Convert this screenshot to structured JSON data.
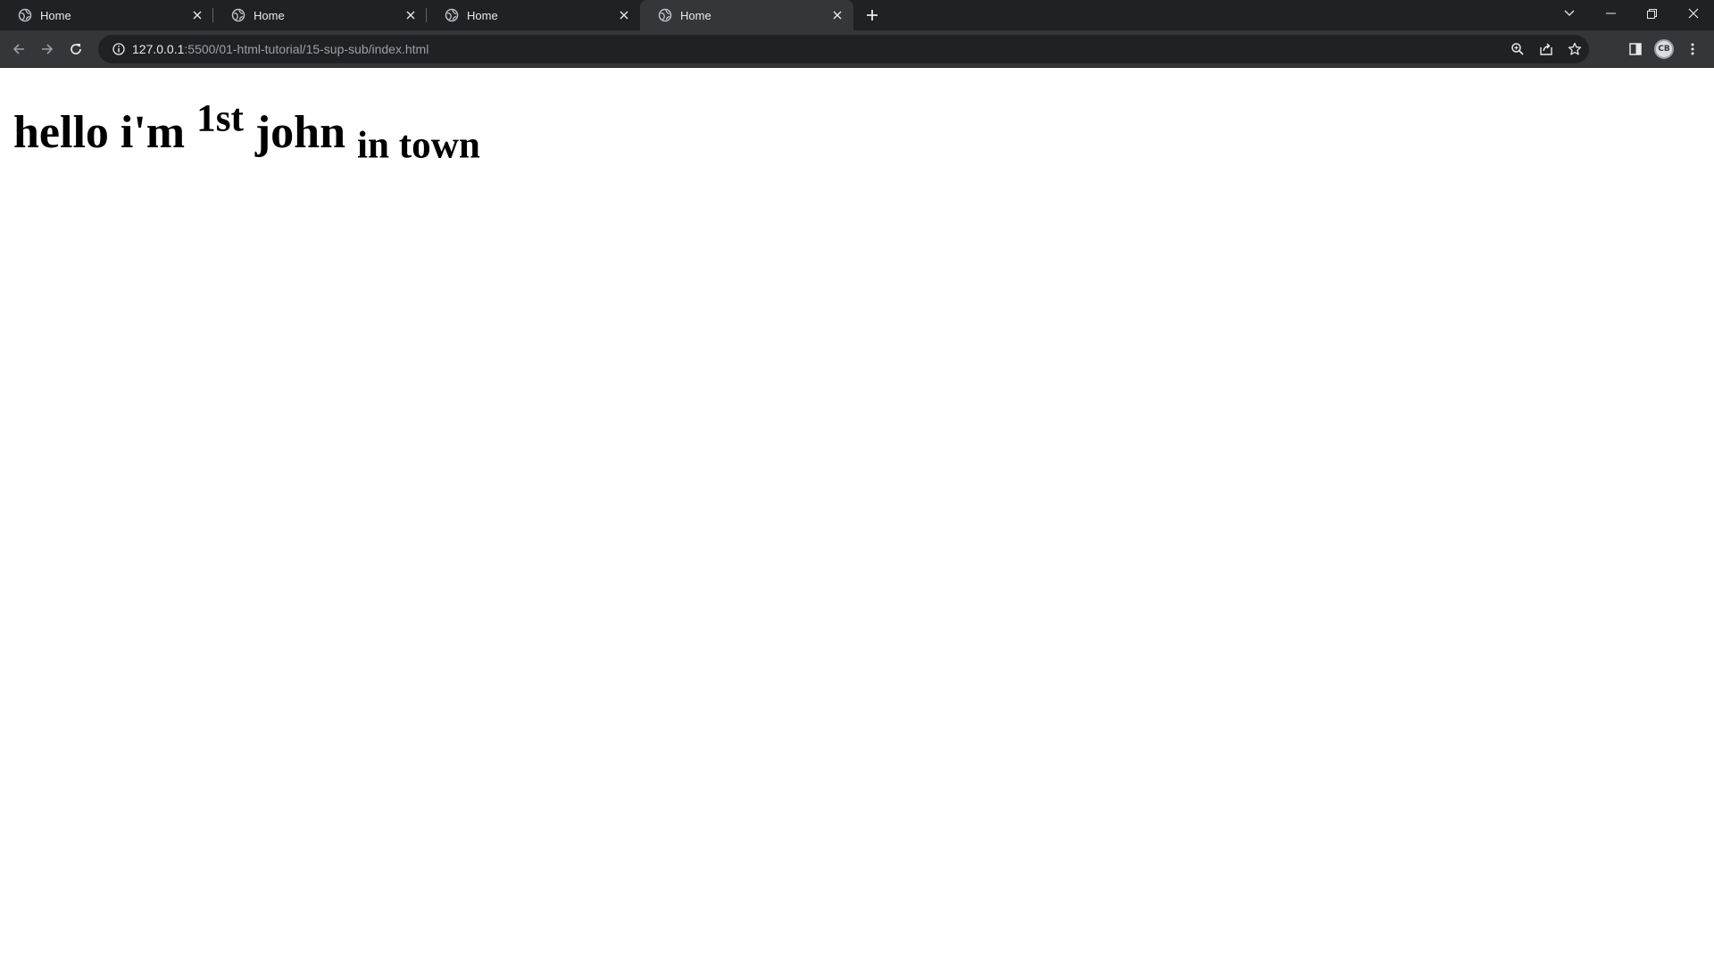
{
  "browser": {
    "tabs": [
      {
        "title": "Home",
        "active": false,
        "favicon": "globe-icon"
      },
      {
        "title": "Home",
        "active": false,
        "favicon": "globe-icon"
      },
      {
        "title": "Home",
        "active": false,
        "favicon": "globe-icon"
      },
      {
        "title": "Home",
        "active": true,
        "favicon": "globe-icon"
      }
    ],
    "address": {
      "host": "127.0.0.1",
      "path": ":5500/01-html-tutorial/15-sup-sub/index.html"
    },
    "avatar_initials": "CB"
  },
  "content": {
    "heading_before": "hello i'm ",
    "superscript": "1st",
    "heading_middle": " john ",
    "subscript": "in town"
  },
  "colors": {
    "tabstrip_bg": "#202124",
    "toolbar_bg": "#35363a",
    "omnibox_bg": "#202124",
    "text_light": "#e8eaed",
    "text_dim": "#9aa0a6",
    "page_bg": "#ffffff",
    "heading": "#000000"
  }
}
